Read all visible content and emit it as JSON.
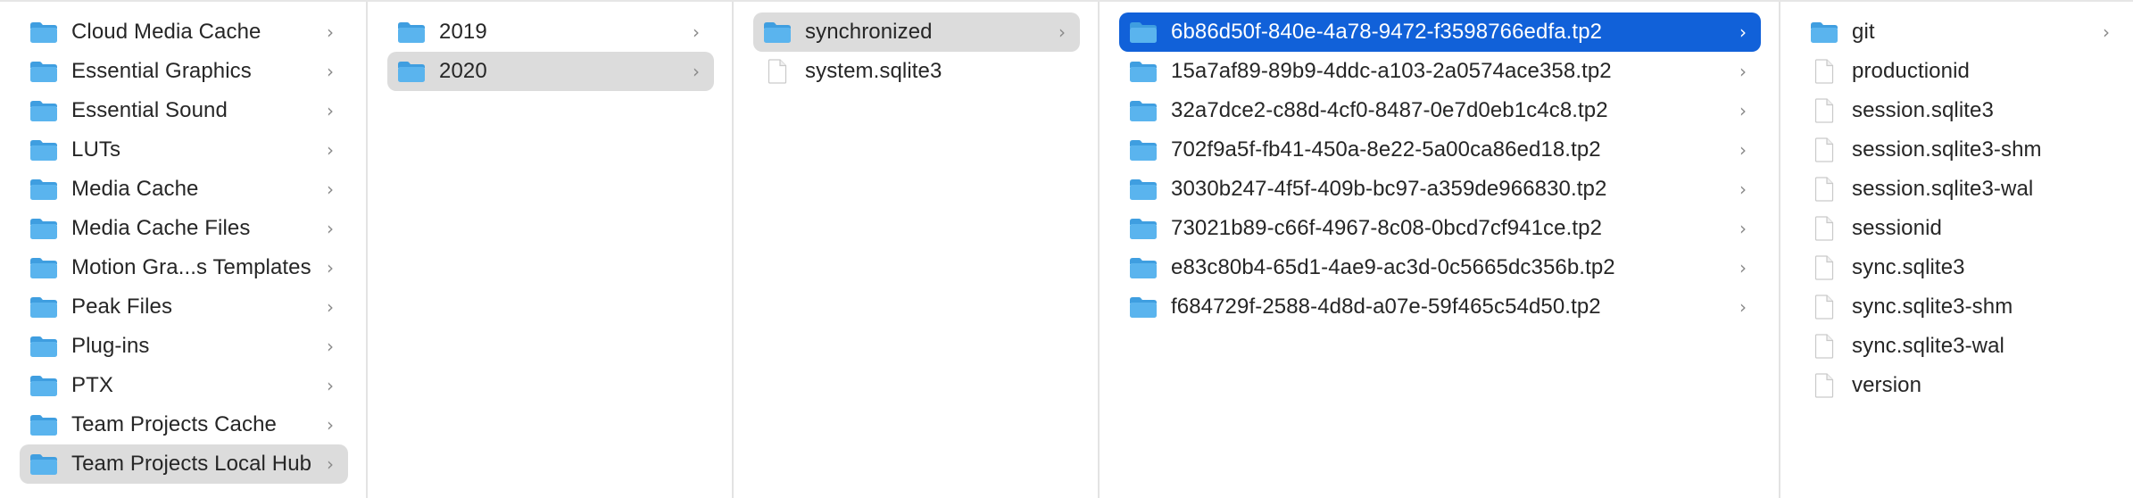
{
  "columns": [
    {
      "items": [
        {
          "name": "Cloud Media Cache",
          "kind": "folder",
          "selection": "none"
        },
        {
          "name": "Essential Graphics",
          "kind": "folder",
          "selection": "none"
        },
        {
          "name": "Essential Sound",
          "kind": "folder",
          "selection": "none"
        },
        {
          "name": "LUTs",
          "kind": "folder",
          "selection": "none"
        },
        {
          "name": "Media Cache",
          "kind": "folder",
          "selection": "none"
        },
        {
          "name": "Media Cache Files",
          "kind": "folder",
          "selection": "none"
        },
        {
          "name": "Motion Gra...s Templates",
          "kind": "folder",
          "selection": "none"
        },
        {
          "name": "Peak Files",
          "kind": "folder",
          "selection": "none"
        },
        {
          "name": "Plug-ins",
          "kind": "folder",
          "selection": "none"
        },
        {
          "name": "PTX",
          "kind": "folder",
          "selection": "none"
        },
        {
          "name": "Team Projects Cache",
          "kind": "folder",
          "selection": "none"
        },
        {
          "name": "Team Projects Local Hub",
          "kind": "folder",
          "selection": "inactive"
        }
      ]
    },
    {
      "items": [
        {
          "name": "2019",
          "kind": "folder",
          "selection": "none"
        },
        {
          "name": "2020",
          "kind": "folder",
          "selection": "inactive"
        }
      ]
    },
    {
      "items": [
        {
          "name": "synchronized",
          "kind": "folder",
          "selection": "inactive"
        },
        {
          "name": "system.sqlite3",
          "kind": "file",
          "selection": "none"
        }
      ]
    },
    {
      "items": [
        {
          "name": "6b86d50f-840e-4a78-9472-f3598766edfa.tp2",
          "kind": "folder",
          "selection": "active"
        },
        {
          "name": "15a7af89-89b9-4ddc-a103-2a0574ace358.tp2",
          "kind": "folder",
          "selection": "none"
        },
        {
          "name": "32a7dce2-c88d-4cf0-8487-0e7d0eb1c4c8.tp2",
          "kind": "folder",
          "selection": "none"
        },
        {
          "name": "702f9a5f-fb41-450a-8e22-5a00ca86ed18.tp2",
          "kind": "folder",
          "selection": "none"
        },
        {
          "name": "3030b247-4f5f-409b-bc97-a359de966830.tp2",
          "kind": "folder",
          "selection": "none"
        },
        {
          "name": "73021b89-c66f-4967-8c08-0bcd7cf941ce.tp2",
          "kind": "folder",
          "selection": "none"
        },
        {
          "name": "e83c80b4-65d1-4ae9-ac3d-0c5665dc356b.tp2",
          "kind": "folder",
          "selection": "none"
        },
        {
          "name": "f684729f-2588-4d8d-a07e-59f465c54d50.tp2",
          "kind": "folder",
          "selection": "none"
        }
      ]
    },
    {
      "items": [
        {
          "name": "git",
          "kind": "folder",
          "selection": "none"
        },
        {
          "name": "productionid",
          "kind": "file",
          "selection": "none"
        },
        {
          "name": "session.sqlite3",
          "kind": "file",
          "selection": "none"
        },
        {
          "name": "session.sqlite3-shm",
          "kind": "file",
          "selection": "none"
        },
        {
          "name": "session.sqlite3-wal",
          "kind": "file",
          "selection": "none"
        },
        {
          "name": "sessionid",
          "kind": "file",
          "selection": "none"
        },
        {
          "name": "sync.sqlite3",
          "kind": "file",
          "selection": "none"
        },
        {
          "name": "sync.sqlite3-shm",
          "kind": "file",
          "selection": "none"
        },
        {
          "name": "sync.sqlite3-wal",
          "kind": "file",
          "selection": "none"
        },
        {
          "name": "version",
          "kind": "file",
          "selection": "none"
        }
      ]
    }
  ],
  "icons": {
    "folder": "folder-icon",
    "file": "document-icon",
    "disclosure": "chevron-right-icon"
  },
  "colors": {
    "selection_active": "#1161d9",
    "selection_inactive": "#dcdcdc",
    "folder_body": "#5ab4ee",
    "folder_tab": "#3f9ee0"
  }
}
